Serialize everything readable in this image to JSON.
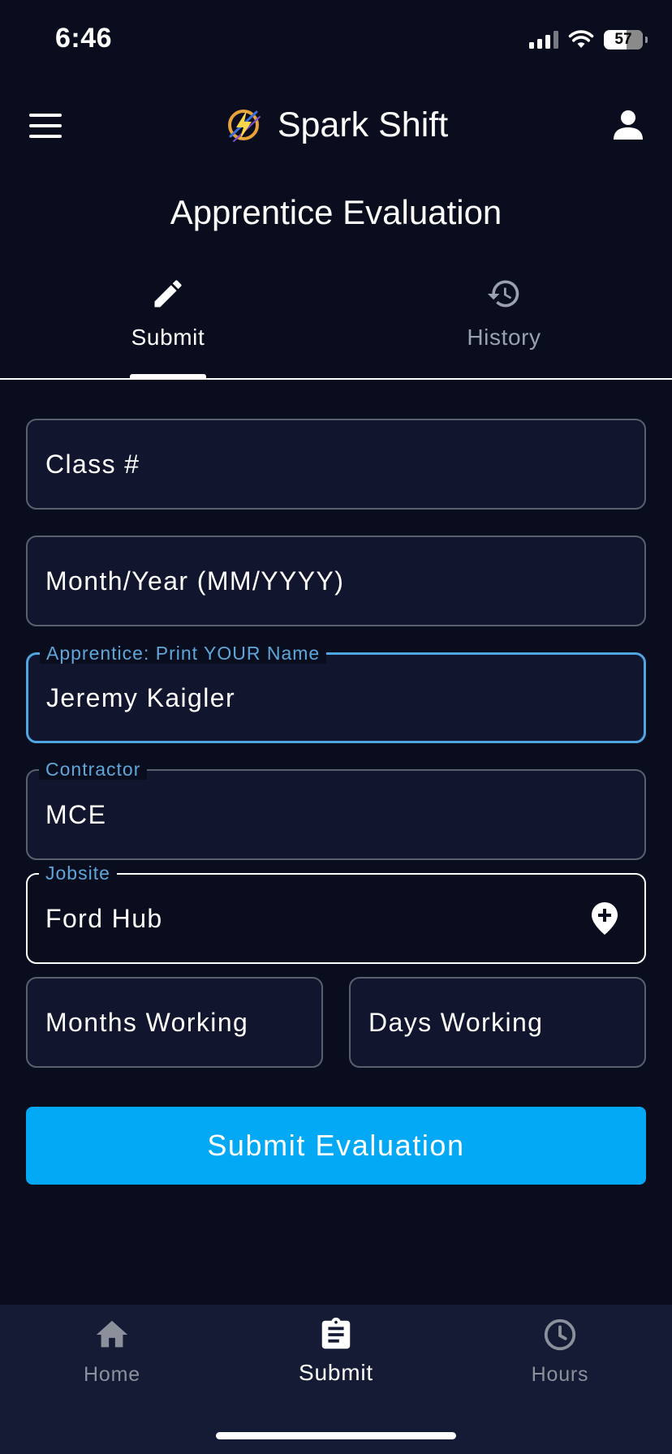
{
  "status_bar": {
    "time": "6:46",
    "battery": "57"
  },
  "header": {
    "app_name": "Spark Shift"
  },
  "page": {
    "title": "Apprentice Evaluation"
  },
  "tabs": [
    {
      "label": "Submit",
      "icon": "pencil-icon",
      "active": true
    },
    {
      "label": "History",
      "icon": "history-icon",
      "active": false
    }
  ],
  "form": {
    "class_number": {
      "placeholder": "Class #",
      "value": ""
    },
    "month_year": {
      "placeholder": "Month/Year (MM/YYYY)",
      "value": ""
    },
    "apprentice_name": {
      "label": "Apprentice: Print YOUR Name",
      "value": "Jeremy Kaigler"
    },
    "contractor": {
      "label": "Contractor",
      "value": "MCE"
    },
    "jobsite": {
      "label": "Jobsite",
      "value": "Ford Hub"
    },
    "months_working": {
      "placeholder": "Months Working",
      "value": ""
    },
    "days_working": {
      "placeholder": "Days Working",
      "value": ""
    },
    "submit_label": "Submit Evaluation"
  },
  "bottom_nav": [
    {
      "label": "Home",
      "icon": "home-icon",
      "active": false
    },
    {
      "label": "Submit",
      "icon": "clipboard-icon",
      "active": true
    },
    {
      "label": "Hours",
      "icon": "clock-icon",
      "active": false
    }
  ],
  "colors": {
    "background": "#0a0d1e",
    "field_background": "#11152d",
    "accent": "#03a9f4",
    "label_blue": "#5fa7d9",
    "nav_background": "#151b35"
  }
}
